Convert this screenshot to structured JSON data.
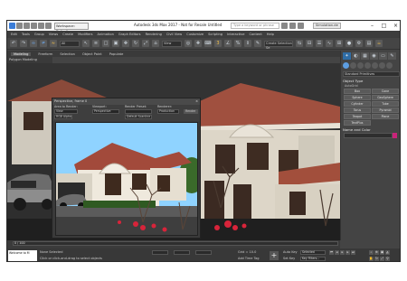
{
  "titlebar": {
    "workspace": "Workspace: Default",
    "app_title": "Autodesk 3ds Max 2017 - Not for Resale    Untitled",
    "search_placeholder": "Type a keyword or phrase",
    "sign_in": "Simulation.de"
  },
  "menu": [
    "Edit",
    "Tools",
    "Group",
    "Views",
    "Create",
    "Modifiers",
    "Animation",
    "Graph Editors",
    "Rendering",
    "Civil View",
    "Customize",
    "Scripting",
    "Interactive",
    "Content",
    "Help"
  ],
  "toolbar": {
    "filter": "All",
    "view": "View",
    "selection_set": "Create Selection Se"
  },
  "ribbon": {
    "tabs": [
      "Modeling",
      "Freeform",
      "Selection",
      "Object Paint",
      "Populate"
    ],
    "active_tab": "Modeling",
    "sub_label": "Polygon Modeling"
  },
  "render_window": {
    "title": "Perspective, frame 0",
    "area_label": "Area to Render:",
    "area_value": "View",
    "viewport_label": "Viewport:",
    "viewport_value": "Perspective",
    "preset_label": "Render Preset:",
    "renderer_label": "Renderer:",
    "renderer_value": "Production",
    "output_value": "Default Scanline",
    "channel": "RGB Alpha",
    "render_button": "Render"
  },
  "command_panel": {
    "category": "Standard Primitives",
    "object_type_heading": "Object Type",
    "autogrid": "AutoGrid",
    "buttons": [
      "Box",
      "Cone",
      "Sphere",
      "GeoSphere",
      "Cylinder",
      "Tube",
      "Torus",
      "Pyramid",
      "Teapot",
      "Plane",
      "TextPlus"
    ],
    "name_color_heading": "Name and Color",
    "swatch_color": "#c9237a"
  },
  "timeline": {
    "frames": "0 / 100"
  },
  "status": {
    "maxscript": "Welcome to M",
    "none_selected": "None Selected",
    "prompt": "Click or click-and-drag to select objects",
    "grid": "Grid = 10.0",
    "add_time_tag": "Add Time Tag",
    "auto_key": "Auto Key",
    "set_key": "Set Key",
    "selected": "Selected",
    "key_filters": "Key Filters..."
  },
  "colors": {
    "sky": "#8fd3ff",
    "accent": "#2f6da6"
  }
}
